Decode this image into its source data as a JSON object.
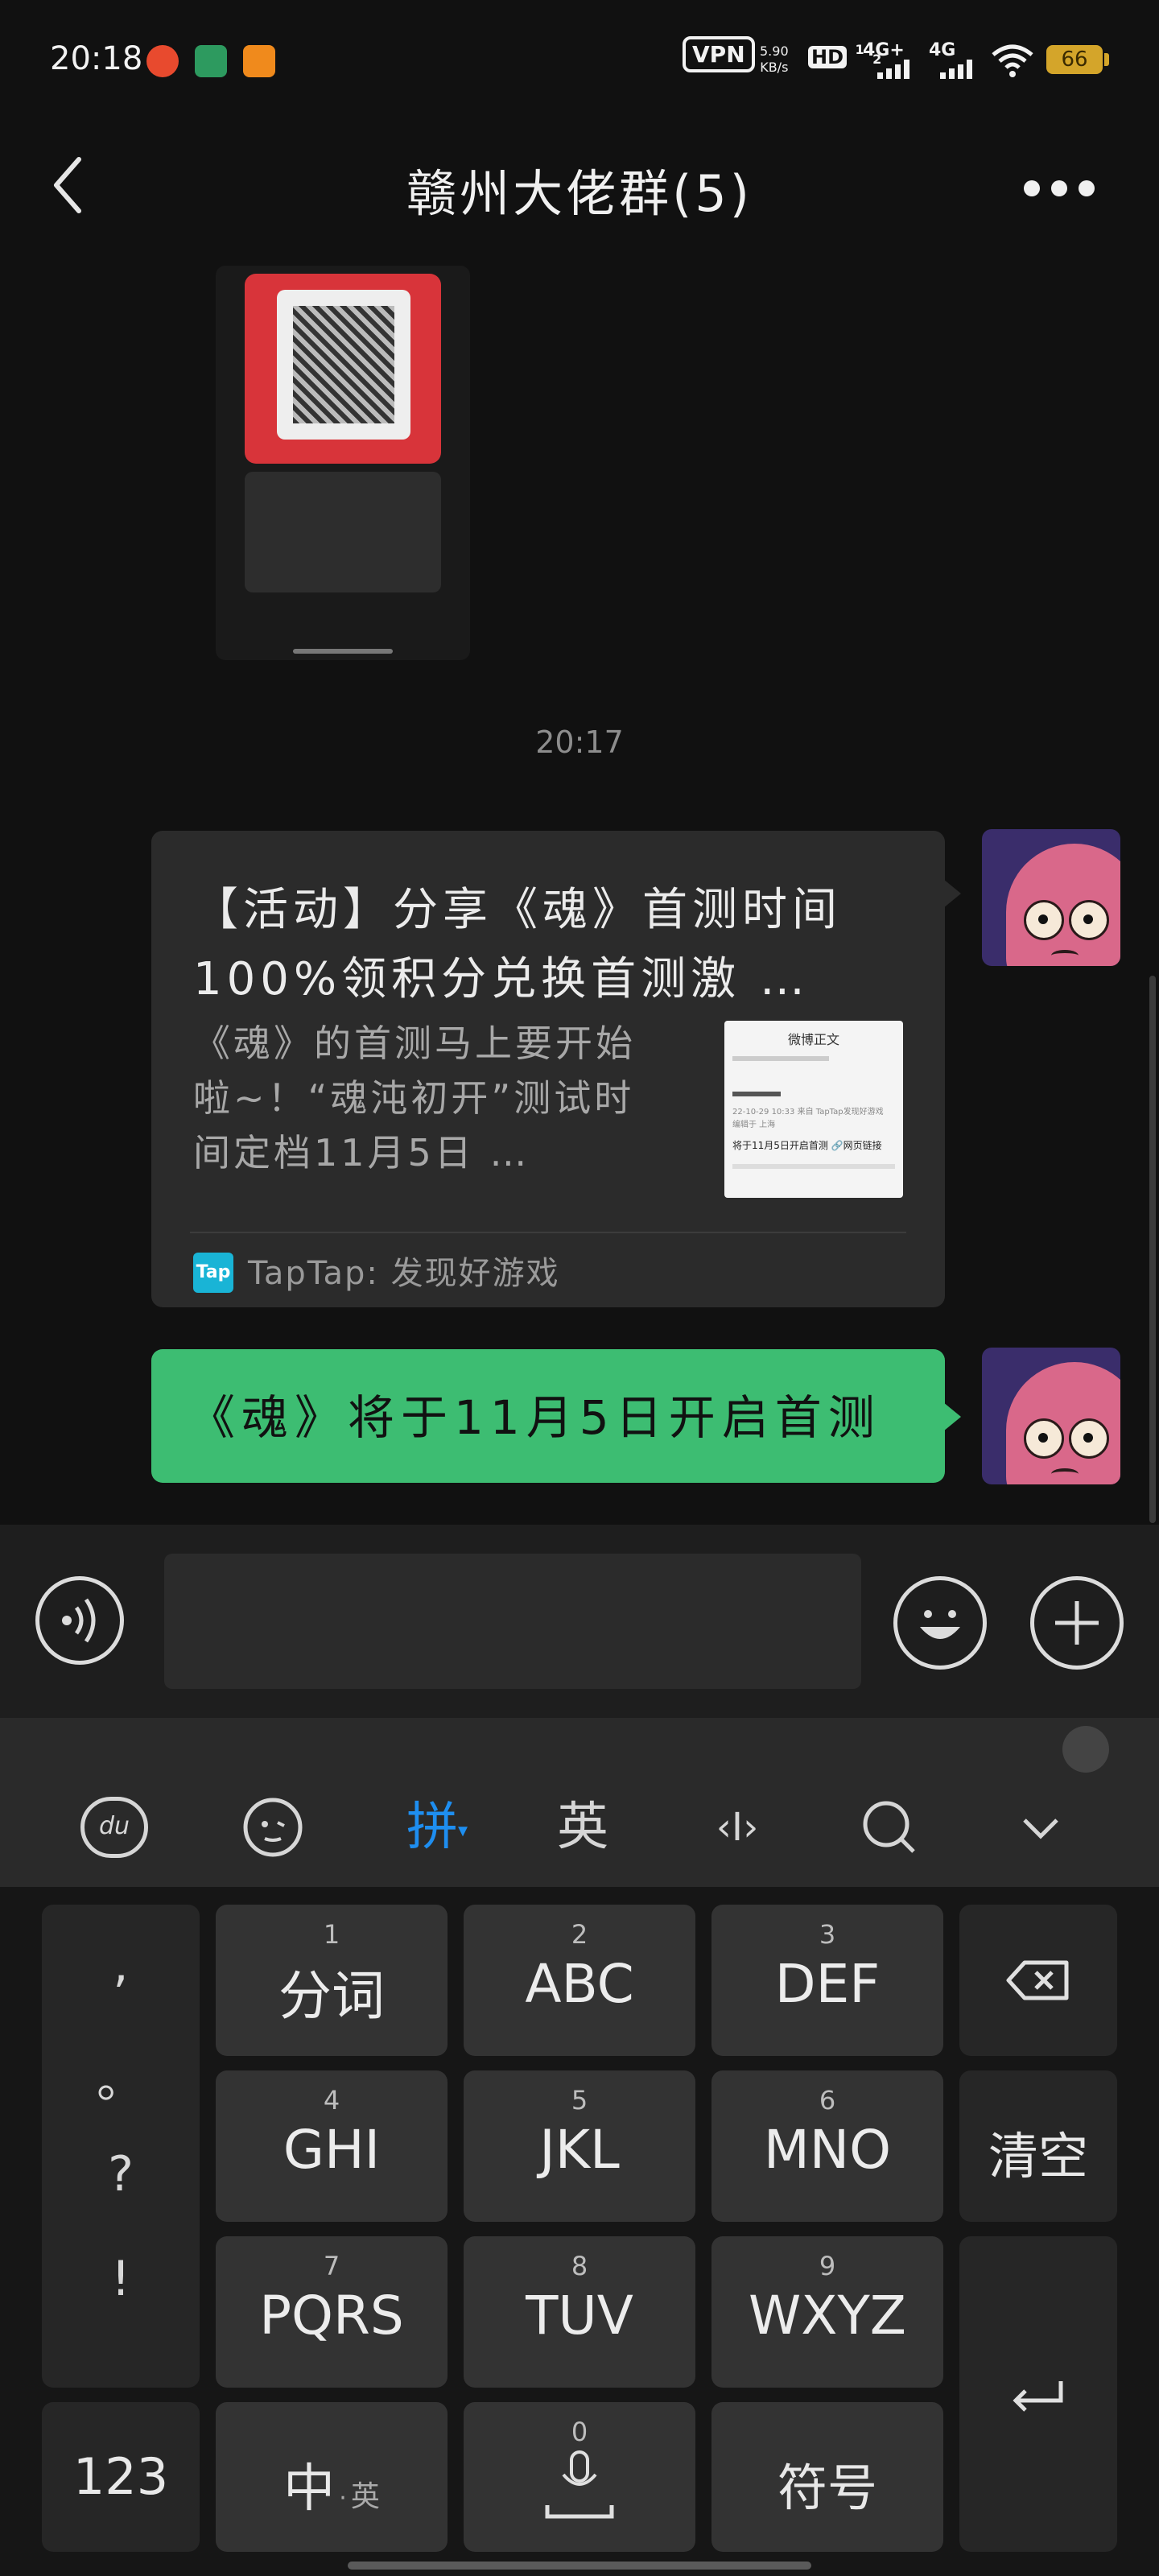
{
  "status_bar": {
    "time": "20:18",
    "vpn_label": "VPN",
    "net_speed_value": "5.90",
    "net_speed_unit": "KB/s",
    "hd_label": "HD",
    "hd_sub": "1",
    "hd_sub2": "2",
    "signal1_label": "4G+",
    "signal2_label": "4G",
    "battery_level": "66",
    "icons": [
      "app-orange-icon",
      "app-green-icon",
      "app-weibo-icon",
      "wifi-icon",
      "signal-icon",
      "battery-icon"
    ]
  },
  "header": {
    "title": "赣州大佬群(5)",
    "back_icon": "chevron-left-icon",
    "more_icon": "more-dots-icon"
  },
  "chat": {
    "timestamp": "20:17",
    "share_card": {
      "title": "【活动】分享《魂》首测时间100%领积分兑换首测激 …",
      "description": "《魂》的首测马上要开始啦~！“魂沌初开”测试时间定档11月5日 …",
      "source": "TapTap: 发现好游戏",
      "source_icon_label": "Tap",
      "thumbnail": {
        "header": "微博正文",
        "line1": "22-10-29 10:33  来自 TapTap发现好游戏",
        "line2": "编辑于 上海",
        "line3": "将于11月5日开启首测 🔗网页链接"
      }
    },
    "text_message": "《魂》将于11月5日开启首测"
  },
  "input_bar": {
    "placeholder": "",
    "voice_icon": "voice-icon",
    "emoji_icon": "emoji-icon",
    "plus_icon": "plus-icon"
  },
  "keyboard": {
    "toolbar": {
      "du_label": "du",
      "pinyin_label": "拼",
      "english_label": "英",
      "cursor_label": "‹I›",
      "search_icon": "search-icon",
      "collapse_icon": "chevron-down-icon",
      "accent_color": "#1e8ef0"
    },
    "punct": [
      ",",
      "。",
      "?",
      "!"
    ],
    "keys": [
      {
        "num": "1",
        "label": "分词"
      },
      {
        "num": "2",
        "label": "ABC"
      },
      {
        "num": "3",
        "label": "DEF"
      },
      {
        "num": "4",
        "label": "GHI"
      },
      {
        "num": "5",
        "label": "JKL"
      },
      {
        "num": "6",
        "label": "MNO"
      },
      {
        "num": "7",
        "label": "PQRS"
      },
      {
        "num": "8",
        "label": "TUV"
      },
      {
        "num": "9",
        "label": "WXYZ"
      }
    ],
    "clear_label": "清空",
    "num_label": "123",
    "lang_label_main": "中",
    "lang_label_sep": "·",
    "lang_label_sub": "英",
    "space_num": "0",
    "symbol_label": "符号"
  }
}
